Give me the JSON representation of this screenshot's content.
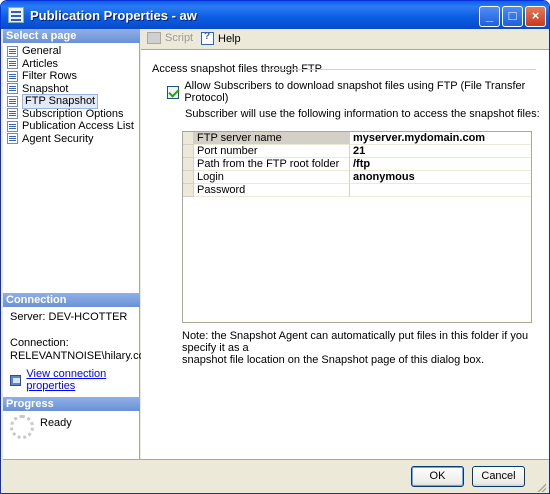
{
  "window": {
    "title": "Publication Properties - aw"
  },
  "sidebar": {
    "select_page_header": "Select a page",
    "items": [
      {
        "label": "General"
      },
      {
        "label": "Articles"
      },
      {
        "label": "Filter Rows"
      },
      {
        "label": "Snapshot"
      },
      {
        "label": "FTP Snapshot"
      },
      {
        "label": "Subscription Options"
      },
      {
        "label": "Publication Access List"
      },
      {
        "label": "Agent Security"
      }
    ],
    "selected_index": 4,
    "connection_header": "Connection",
    "server_line": "Server: DEV-HCOTTER",
    "connection_label": "Connection:",
    "connection_value": "RELEVANTNOISE\\hilary.cotter",
    "view_connection_link": "View connection properties",
    "progress_header": "Progress",
    "progress_status": "Ready"
  },
  "toolbar": {
    "script_label": "Script",
    "help_label": "Help"
  },
  "main": {
    "group_title": "Access snapshot files through FTP",
    "allow_ftp_checkbox": {
      "label": "Allow Subscribers to download snapshot files using FTP (File Transfer Protocol)",
      "checked": true
    },
    "info_text": "Subscriber will use the following information to access the snapshot files:",
    "grid_rows": [
      {
        "name": "FTP server name",
        "value": "myserver.mydomain.com"
      },
      {
        "name": "Port number",
        "value": "21"
      },
      {
        "name": "Path from the FTP root folder",
        "value": "/ftp"
      },
      {
        "name": "Login",
        "value": "anonymous"
      },
      {
        "name": "Password",
        "value": ""
      }
    ],
    "note_line1": "Note: the Snapshot Agent can automatically put files in this folder if you specify it as a",
    "note_line2": "snapshot file location on the Snapshot page of this dialog box."
  },
  "buttons": {
    "ok_label": "OK",
    "cancel_label": "Cancel"
  }
}
